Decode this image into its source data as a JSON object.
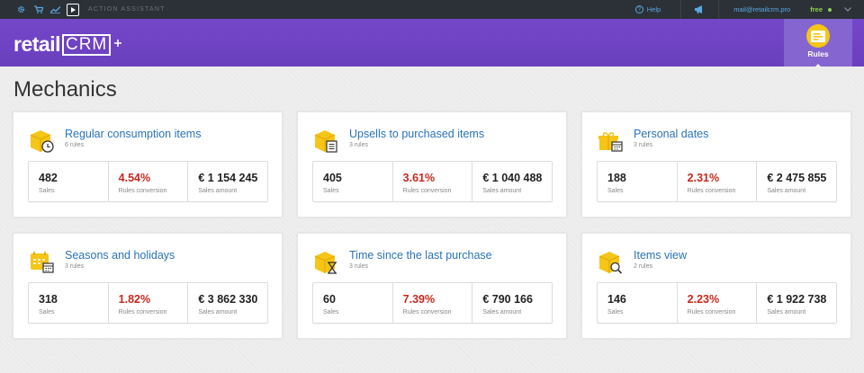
{
  "topbar": {
    "title": "ACTION ASSISTANT",
    "help_label": "Help",
    "email": "mail@retailcrm.pro",
    "plan": "free"
  },
  "header": {
    "logo_text": "retail",
    "logo_crm": "CRM",
    "rules_label": "Rules"
  },
  "page": {
    "title": "Mechanics"
  },
  "colors": {
    "brand_purple": "#6a3fbd",
    "link_blue": "#2a73b6",
    "conversion_red": "#c9281c",
    "icon_yellow": "#f5c518"
  },
  "cards": [
    {
      "title": "Regular consumption items",
      "sub": "6 rules",
      "icon": "box-clock-icon",
      "sales": "482",
      "sales_label": "Sales",
      "conv": "4.54%",
      "conv_label": "Rules conversion",
      "amount": "€ 1 154 245",
      "amount_label": "Sales amount"
    },
    {
      "title": "Upsells to purchased items",
      "sub": "3 rules",
      "icon": "box-list-icon",
      "sales": "405",
      "sales_label": "Sales",
      "conv": "3.61%",
      "conv_label": "Rules conversion",
      "amount": "€ 1 040 488",
      "amount_label": "Sales amount"
    },
    {
      "title": "Personal dates",
      "sub": "3 rules",
      "icon": "gift-calendar-icon",
      "sales": "188",
      "sales_label": "Sales",
      "conv": "2.31%",
      "conv_label": "Rules conversion",
      "amount": "€ 2 475 855",
      "amount_label": "Sales amount"
    },
    {
      "title": "Seasons and holidays",
      "sub": "3 rules",
      "icon": "calendar-icon",
      "sales": "318",
      "sales_label": "Sales",
      "conv": "1.82%",
      "conv_label": "Rules conversion",
      "amount": "€ 3 862 330",
      "amount_label": "Sales amount"
    },
    {
      "title": "Time since the last purchase",
      "sub": "3 rules",
      "icon": "box-hourglass-icon",
      "sales": "60",
      "sales_label": "Sales",
      "conv": "7.39%",
      "conv_label": "Rules conversion",
      "amount": "€ 790 166",
      "amount_label": "Sales amount"
    },
    {
      "title": "Items view",
      "sub": "2 rules",
      "icon": "box-search-icon",
      "sales": "146",
      "sales_label": "Sales",
      "conv": "2.23%",
      "conv_label": "Rules conversion",
      "amount": "€ 1 922 738",
      "amount_label": "Sales amount"
    }
  ]
}
